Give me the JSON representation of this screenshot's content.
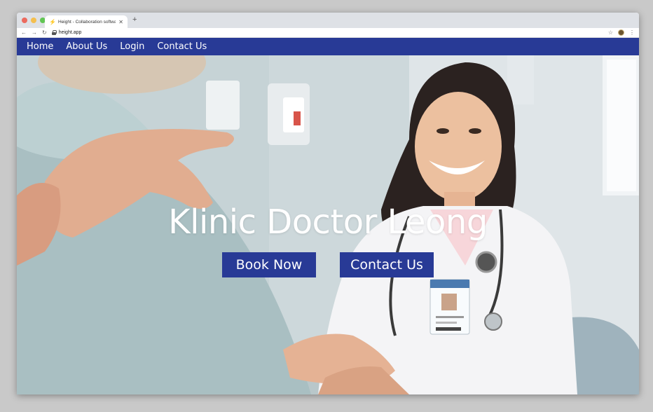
{
  "browser": {
    "tab_title": "Height - Collaboration software f",
    "url": "height.app",
    "traffic_light_colors": [
      "#ec6a5e",
      "#f4bf4f",
      "#61c554"
    ]
  },
  "site": {
    "nav": {
      "items": [
        {
          "label": "Home"
        },
        {
          "label": "About Us"
        },
        {
          "label": "Login"
        },
        {
          "label": "Contact Us"
        }
      ],
      "background": "#283a96"
    },
    "hero": {
      "title": "Klinic Doctor Leong",
      "book_button": "Book Now",
      "contact_button": "Contact Us",
      "button_color": "#283a96"
    }
  }
}
